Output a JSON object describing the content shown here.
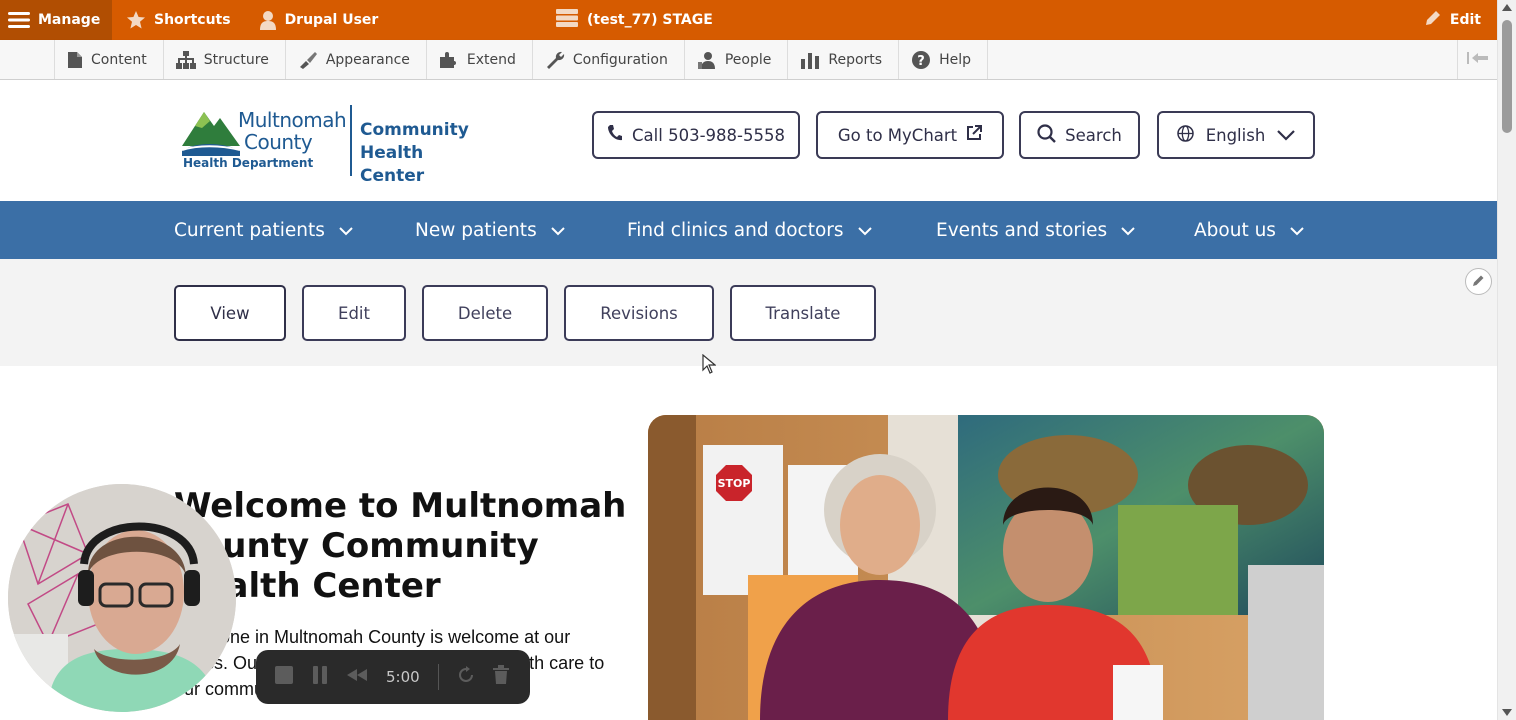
{
  "toolbar": {
    "manage_label": "Manage",
    "shortcuts_label": "Shortcuts",
    "user_label": "Drupal User",
    "environment_label": "(test_77) STAGE",
    "edit_label": "Edit",
    "bar_color": "#d65b00"
  },
  "tray": {
    "items": [
      {
        "label": "Content",
        "icon": "file-icon"
      },
      {
        "label": "Structure",
        "icon": "sitemap-icon"
      },
      {
        "label": "Appearance",
        "icon": "brush-icon"
      },
      {
        "label": "Extend",
        "icon": "puzzle-icon"
      },
      {
        "label": "Configuration",
        "icon": "wrench-icon"
      },
      {
        "label": "People",
        "icon": "person-icon"
      },
      {
        "label": "Reports",
        "icon": "bar-chart-icon"
      },
      {
        "label": "Help",
        "icon": "question-icon"
      }
    ]
  },
  "header": {
    "logo_line1": "Multnomah",
    "logo_line2": "County",
    "logo_subtitle": "Health Department",
    "logo_right_1": "Community",
    "logo_right_2": "Health Center",
    "call_label": "Call 503-988-5558",
    "mychart_label": "Go to MyChart",
    "search_label": "Search",
    "language_label": "English"
  },
  "main_nav": {
    "items": [
      {
        "label": "Current patients"
      },
      {
        "label": "New patients"
      },
      {
        "label": "Find clinics and doctors"
      },
      {
        "label": "Events and stories"
      },
      {
        "label": "About us"
      }
    ],
    "color": "#3b6fa6"
  },
  "tabs": {
    "items": [
      {
        "label": "View",
        "active": true
      },
      {
        "label": "Edit"
      },
      {
        "label": "Delete"
      },
      {
        "label": "Revisions"
      },
      {
        "label": "Translate"
      }
    ]
  },
  "content": {
    "title": "Welcome to Multnomah County Community Health Center",
    "body": "Everyone in Multnomah County is welcome at our clinics. Our teams provide quality whole health care to our community."
  },
  "recorder": {
    "time": "5:00"
  }
}
